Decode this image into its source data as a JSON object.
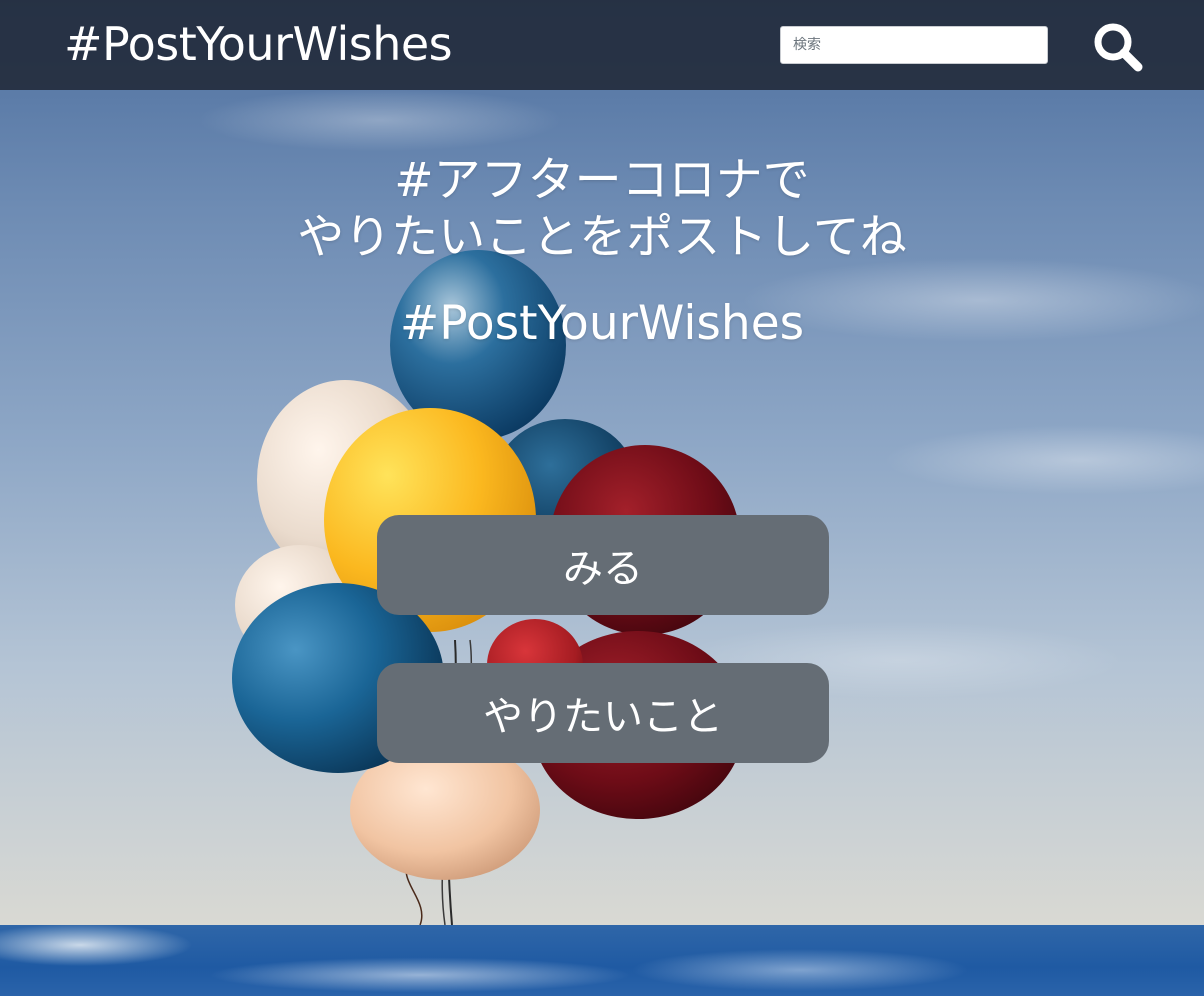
{
  "header": {
    "brand": "#PostYourWishes",
    "search_placeholder": "検索",
    "search_icon": "search-icon"
  },
  "hero": {
    "title_line1": "#アフターコロナで",
    "title_line2": "やりたいことをポストしてね",
    "hashtag": "#PostYourWishes",
    "background_image": "balloons-against-sky"
  },
  "actions": {
    "view_label": "みる",
    "wish_label": "やりたいこと"
  },
  "colors": {
    "header_bg": "#212938",
    "button_bg": "#656d75",
    "text": "#ffffff"
  }
}
